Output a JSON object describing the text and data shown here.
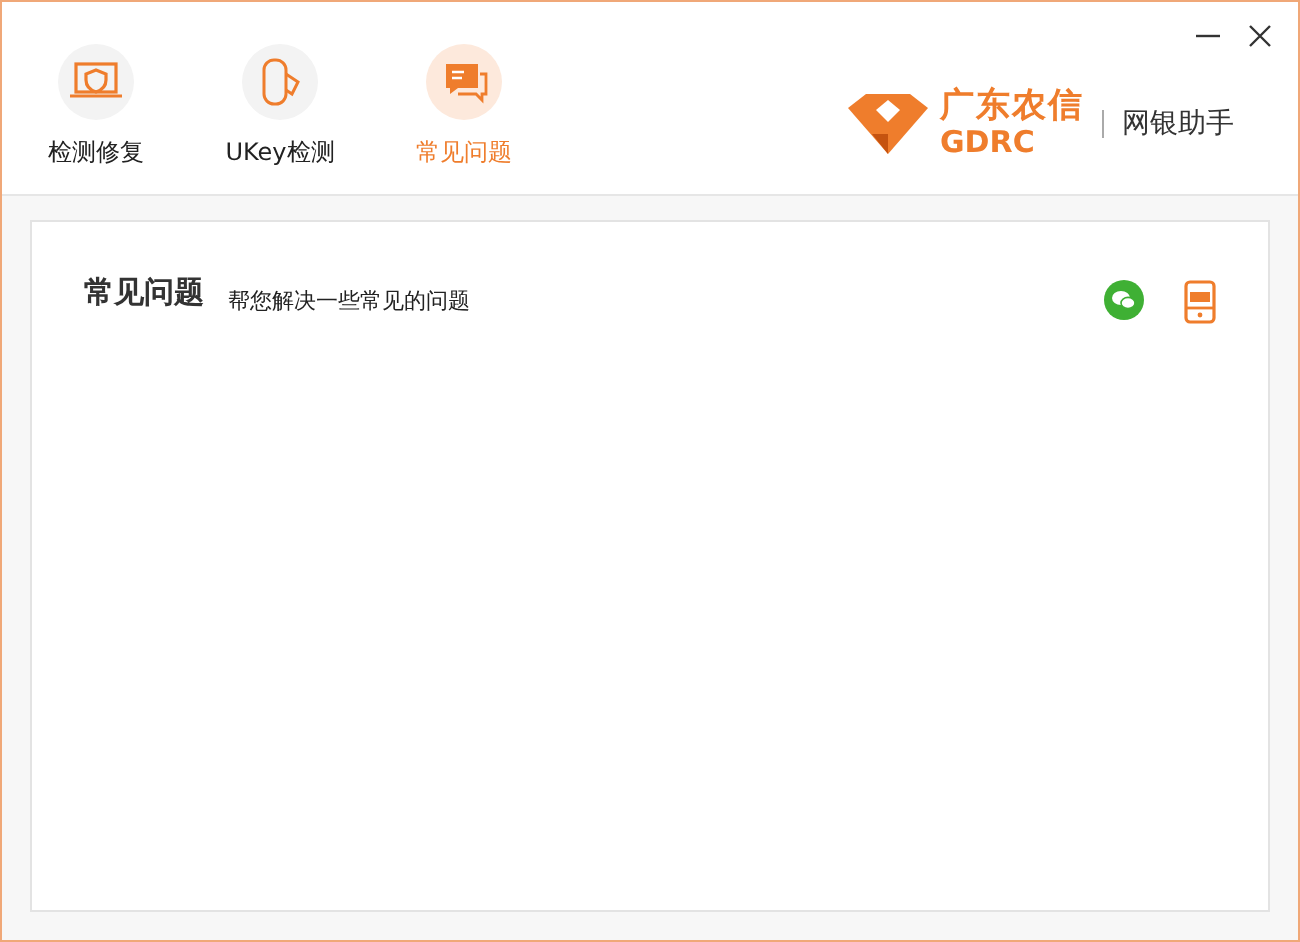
{
  "window": {
    "controls": [
      {
        "kind": "minimize"
      },
      {
        "kind": "close"
      }
    ]
  },
  "tabs": [
    {
      "label": "检测修复",
      "kind": "repair",
      "selected": false
    },
    {
      "label": "UKey检测",
      "kind": "ukey",
      "selected": false
    },
    {
      "label": "常见问题",
      "kind": "faq",
      "selected": true
    }
  ],
  "brand": {
    "name": "广东农信",
    "abbr": "GDRC",
    "product": "网银助手"
  },
  "panel": {
    "title": "常见问题",
    "subtitle": "帮您解决一些常见的问题",
    "actions": [
      {
        "kind": "wechat"
      },
      {
        "kind": "mobile-bank"
      }
    ]
  }
}
